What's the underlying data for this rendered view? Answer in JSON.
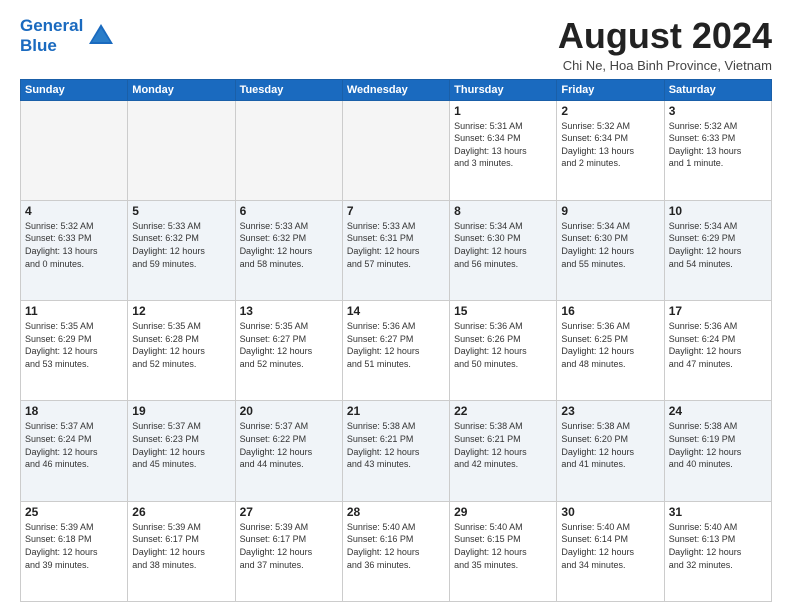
{
  "header": {
    "logo_line1": "General",
    "logo_line2": "Blue",
    "month_title": "August 2024",
    "subtitle": "Chi Ne, Hoa Binh Province, Vietnam"
  },
  "weekdays": [
    "Sunday",
    "Monday",
    "Tuesday",
    "Wednesday",
    "Thursday",
    "Friday",
    "Saturday"
  ],
  "weeks": [
    [
      {
        "day": "",
        "info": ""
      },
      {
        "day": "",
        "info": ""
      },
      {
        "day": "",
        "info": ""
      },
      {
        "day": "",
        "info": ""
      },
      {
        "day": "1",
        "info": "Sunrise: 5:31 AM\nSunset: 6:34 PM\nDaylight: 13 hours\nand 3 minutes."
      },
      {
        "day": "2",
        "info": "Sunrise: 5:32 AM\nSunset: 6:34 PM\nDaylight: 13 hours\nand 2 minutes."
      },
      {
        "day": "3",
        "info": "Sunrise: 5:32 AM\nSunset: 6:33 PM\nDaylight: 13 hours\nand 1 minute."
      }
    ],
    [
      {
        "day": "4",
        "info": "Sunrise: 5:32 AM\nSunset: 6:33 PM\nDaylight: 13 hours\nand 0 minutes."
      },
      {
        "day": "5",
        "info": "Sunrise: 5:33 AM\nSunset: 6:32 PM\nDaylight: 12 hours\nand 59 minutes."
      },
      {
        "day": "6",
        "info": "Sunrise: 5:33 AM\nSunset: 6:32 PM\nDaylight: 12 hours\nand 58 minutes."
      },
      {
        "day": "7",
        "info": "Sunrise: 5:33 AM\nSunset: 6:31 PM\nDaylight: 12 hours\nand 57 minutes."
      },
      {
        "day": "8",
        "info": "Sunrise: 5:34 AM\nSunset: 6:30 PM\nDaylight: 12 hours\nand 56 minutes."
      },
      {
        "day": "9",
        "info": "Sunrise: 5:34 AM\nSunset: 6:30 PM\nDaylight: 12 hours\nand 55 minutes."
      },
      {
        "day": "10",
        "info": "Sunrise: 5:34 AM\nSunset: 6:29 PM\nDaylight: 12 hours\nand 54 minutes."
      }
    ],
    [
      {
        "day": "11",
        "info": "Sunrise: 5:35 AM\nSunset: 6:29 PM\nDaylight: 12 hours\nand 53 minutes."
      },
      {
        "day": "12",
        "info": "Sunrise: 5:35 AM\nSunset: 6:28 PM\nDaylight: 12 hours\nand 52 minutes."
      },
      {
        "day": "13",
        "info": "Sunrise: 5:35 AM\nSunset: 6:27 PM\nDaylight: 12 hours\nand 52 minutes."
      },
      {
        "day": "14",
        "info": "Sunrise: 5:36 AM\nSunset: 6:27 PM\nDaylight: 12 hours\nand 51 minutes."
      },
      {
        "day": "15",
        "info": "Sunrise: 5:36 AM\nSunset: 6:26 PM\nDaylight: 12 hours\nand 50 minutes."
      },
      {
        "day": "16",
        "info": "Sunrise: 5:36 AM\nSunset: 6:25 PM\nDaylight: 12 hours\nand 48 minutes."
      },
      {
        "day": "17",
        "info": "Sunrise: 5:36 AM\nSunset: 6:24 PM\nDaylight: 12 hours\nand 47 minutes."
      }
    ],
    [
      {
        "day": "18",
        "info": "Sunrise: 5:37 AM\nSunset: 6:24 PM\nDaylight: 12 hours\nand 46 minutes."
      },
      {
        "day": "19",
        "info": "Sunrise: 5:37 AM\nSunset: 6:23 PM\nDaylight: 12 hours\nand 45 minutes."
      },
      {
        "day": "20",
        "info": "Sunrise: 5:37 AM\nSunset: 6:22 PM\nDaylight: 12 hours\nand 44 minutes."
      },
      {
        "day": "21",
        "info": "Sunrise: 5:38 AM\nSunset: 6:21 PM\nDaylight: 12 hours\nand 43 minutes."
      },
      {
        "day": "22",
        "info": "Sunrise: 5:38 AM\nSunset: 6:21 PM\nDaylight: 12 hours\nand 42 minutes."
      },
      {
        "day": "23",
        "info": "Sunrise: 5:38 AM\nSunset: 6:20 PM\nDaylight: 12 hours\nand 41 minutes."
      },
      {
        "day": "24",
        "info": "Sunrise: 5:38 AM\nSunset: 6:19 PM\nDaylight: 12 hours\nand 40 minutes."
      }
    ],
    [
      {
        "day": "25",
        "info": "Sunrise: 5:39 AM\nSunset: 6:18 PM\nDaylight: 12 hours\nand 39 minutes."
      },
      {
        "day": "26",
        "info": "Sunrise: 5:39 AM\nSunset: 6:17 PM\nDaylight: 12 hours\nand 38 minutes."
      },
      {
        "day": "27",
        "info": "Sunrise: 5:39 AM\nSunset: 6:17 PM\nDaylight: 12 hours\nand 37 minutes."
      },
      {
        "day": "28",
        "info": "Sunrise: 5:40 AM\nSunset: 6:16 PM\nDaylight: 12 hours\nand 36 minutes."
      },
      {
        "day": "29",
        "info": "Sunrise: 5:40 AM\nSunset: 6:15 PM\nDaylight: 12 hours\nand 35 minutes."
      },
      {
        "day": "30",
        "info": "Sunrise: 5:40 AM\nSunset: 6:14 PM\nDaylight: 12 hours\nand 34 minutes."
      },
      {
        "day": "31",
        "info": "Sunrise: 5:40 AM\nSunset: 6:13 PM\nDaylight: 12 hours\nand 32 minutes."
      }
    ]
  ]
}
